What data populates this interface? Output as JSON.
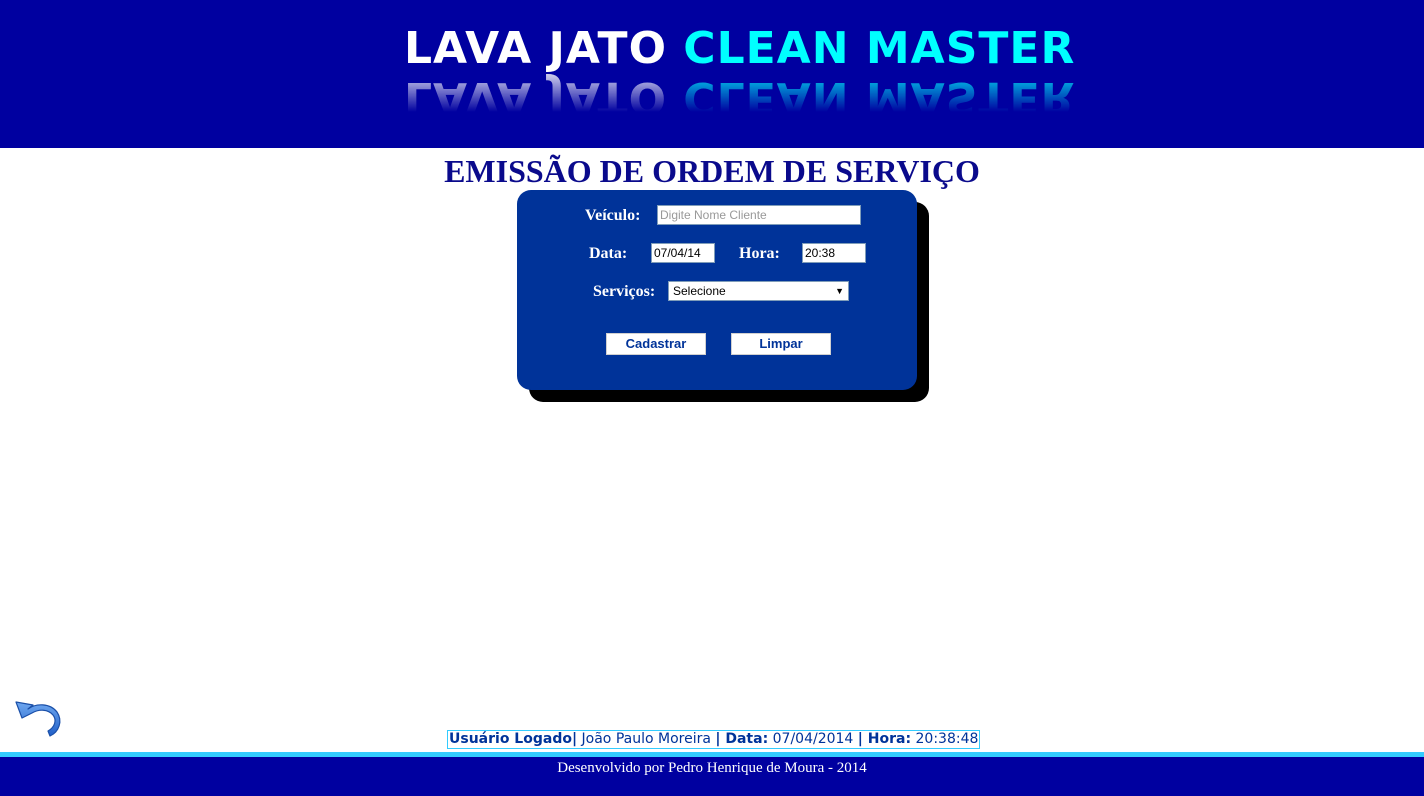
{
  "header": {
    "logo_part1": "LAVA JATO",
    "logo_part2": "CLEAN MASTER"
  },
  "page_title": "EMISSÃO DE ORDEM DE SERVIÇO",
  "form": {
    "veiculo_label": "Veículo:",
    "veiculo_placeholder": "Digite Nome Cliente",
    "data_label": "Data:",
    "data_value": "07/04/14",
    "hora_label": "Hora:",
    "hora_value": "20:38",
    "servicos_label": "Serviços:",
    "servicos_selected": "Selecione",
    "cadastrar_label": "Cadastrar",
    "limpar_label": "Limpar"
  },
  "status": {
    "user_label": "Usuário Logado|",
    "user_name": "João Paulo Moreira",
    "data_label": "| Data:",
    "data_value": "07/04/2014",
    "hora_label": "| Hora:",
    "hora_value": "20:38:48"
  },
  "footer": {
    "credit": "Desenvolvido por Pedro Henrique de Moura - 2014"
  },
  "icons": {
    "back": "undo-arrow-icon"
  },
  "colors": {
    "header_bg": "#0000a0",
    "panel_bg": "#003399",
    "logo_accent": "#00ffff",
    "title_color": "#0a0a8c",
    "footer_line": "#33ccff"
  }
}
